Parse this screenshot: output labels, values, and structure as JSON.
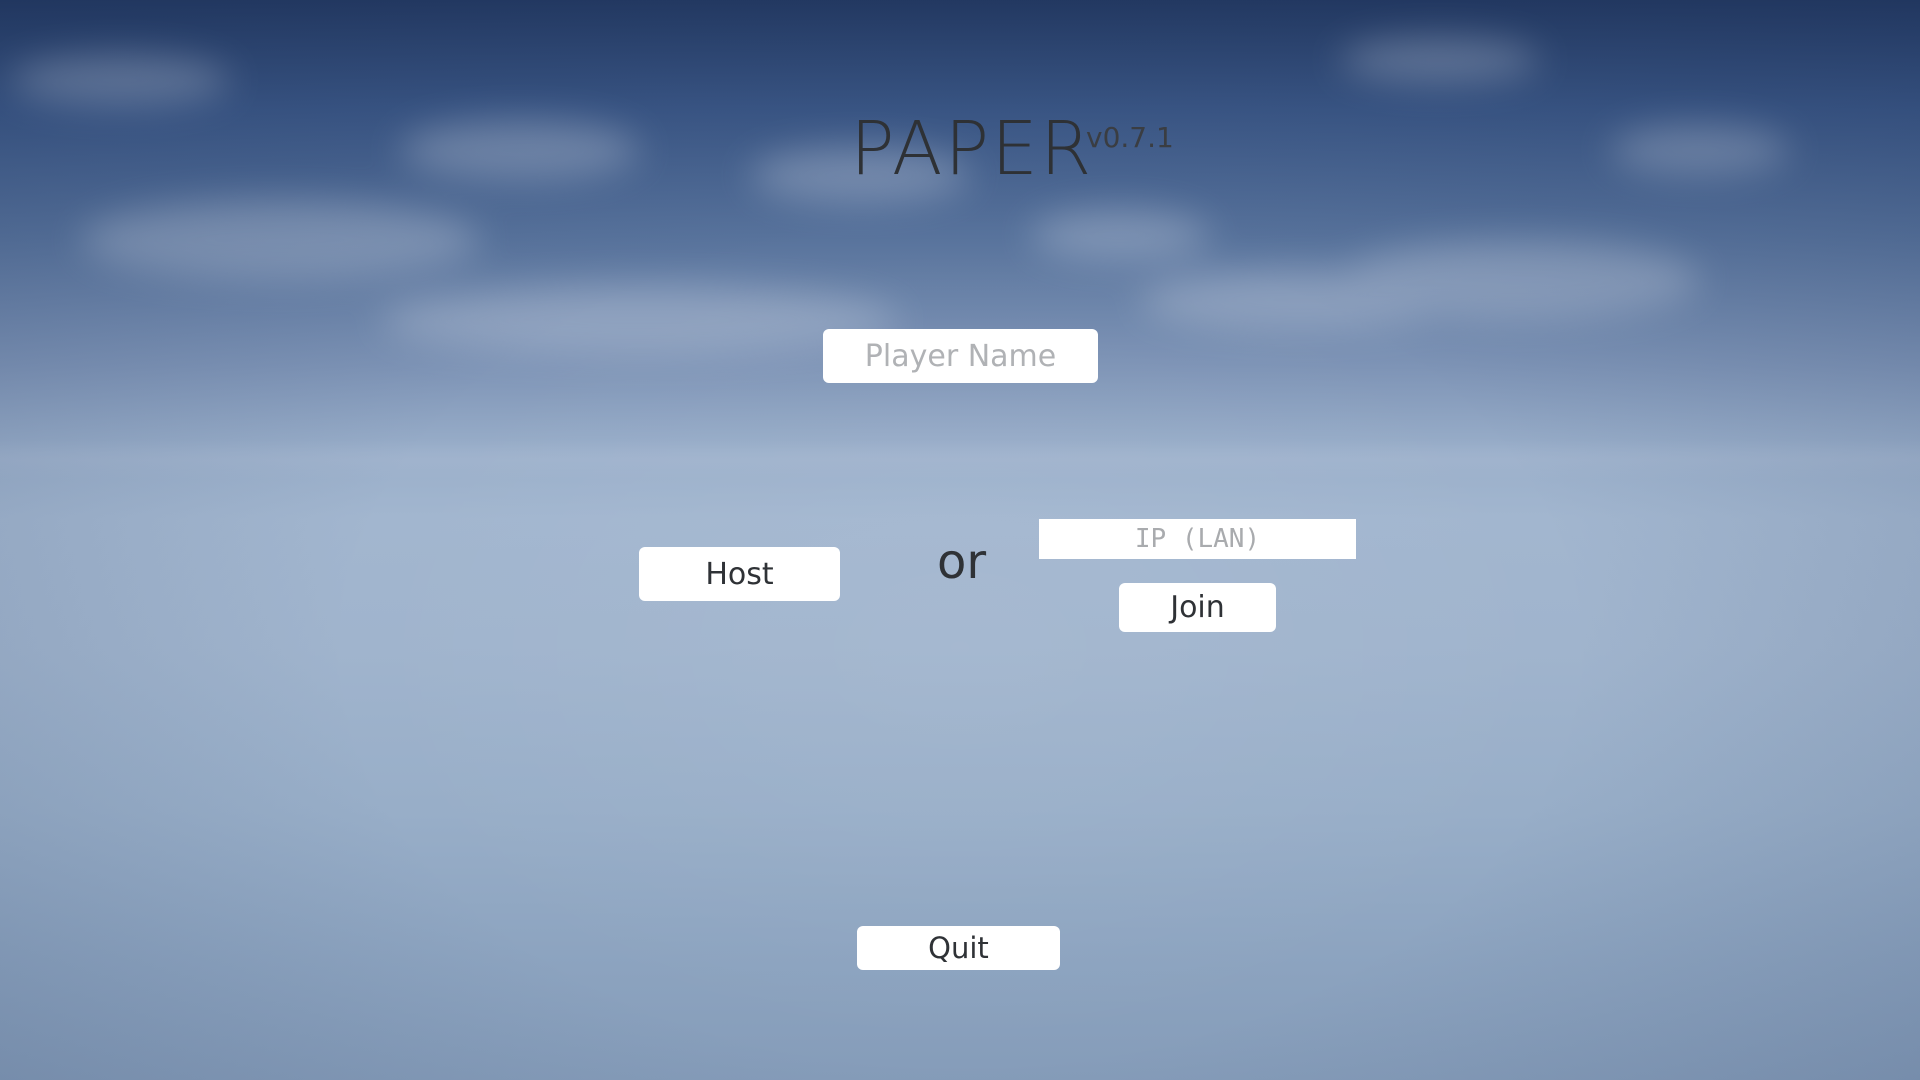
{
  "game": {
    "title": "PAPER",
    "version": "v0.7.1"
  },
  "player_name": {
    "value": "",
    "placeholder": "Player Name"
  },
  "host": {
    "label": "Host"
  },
  "separator": {
    "label": "or"
  },
  "ip": {
    "value": "",
    "placeholder": "IP (LAN)"
  },
  "join": {
    "label": "Join"
  },
  "quit": {
    "label": "Quit"
  },
  "theme": {
    "button_bg": "#ffffff",
    "text": "#2f3236",
    "placeholder": "#b0b2b5",
    "sky_top": "#243a63",
    "sky_bottom": "#859cb9"
  }
}
